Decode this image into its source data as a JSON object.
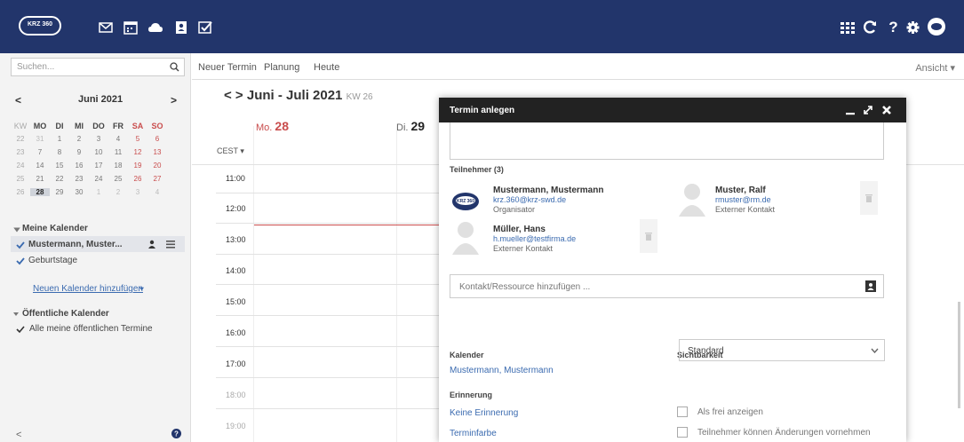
{
  "app": {
    "logo_text": "KRZ 360"
  },
  "topbar": {
    "left_icons": [
      "mail-icon",
      "calendar-icon",
      "cloud-icon",
      "contacts-icon",
      "tasks-icon"
    ],
    "right_icons": [
      "apps-grid-icon",
      "refresh-icon",
      "help-icon",
      "settings-icon",
      "user-avatar-icon"
    ],
    "help_glyph": "?"
  },
  "sidebar": {
    "search_placeholder": "Suchen...",
    "month_title": "Juni 2021",
    "prev": "<",
    "next": ">",
    "weekday_headers": [
      "KW",
      "MO",
      "DI",
      "MI",
      "DO",
      "FR",
      "SA",
      "SO"
    ],
    "weeks": [
      [
        "22",
        "31",
        "1",
        "2",
        "3",
        "4",
        "5",
        "6"
      ],
      [
        "23",
        "7",
        "8",
        "9",
        "10",
        "11",
        "12",
        "13"
      ],
      [
        "24",
        "14",
        "15",
        "16",
        "17",
        "18",
        "19",
        "20"
      ],
      [
        "25",
        "21",
        "22",
        "23",
        "24",
        "25",
        "26",
        "27"
      ],
      [
        "26",
        "28",
        "29",
        "30",
        "1",
        "2",
        "3",
        "4"
      ]
    ],
    "my_calendars_label": "Meine Kalender",
    "calendar_item": "Mustermann, Muster...",
    "birthdays": "Geburtstage",
    "add_calendar_link": "Neuen Kalender hinzufügen",
    "public_calendars_label": "Öffentliche Kalender",
    "public_item": "Alle meine öffentlichen Termine",
    "collapse": "<"
  },
  "toolbar": {
    "new_event": "Neuer Termin",
    "planning": "Planung",
    "today": "Heute",
    "view": "Ansicht"
  },
  "calendar": {
    "range_title": "Juni - Juli 2021",
    "week_label": "KW 26",
    "nav_glyphs": "< >",
    "day1_prefix": "Mo.",
    "day1_num": "28",
    "day2_prefix": "Di.",
    "day2_num": "29",
    "timezone": "CEST",
    "times": [
      "11:00",
      "12:00",
      "13:00",
      "14:00",
      "15:00",
      "16:00",
      "17:00",
      "18:00",
      "19:00"
    ]
  },
  "dialog": {
    "title": "Termin anlegen",
    "participants_label": "Teilnehmer (3)",
    "participants": [
      {
        "name": "Mustermann, Mustermann",
        "email": "krz.360@krz-swd.de",
        "role": "Organisator"
      },
      {
        "name": "Muster, Ralf",
        "email": "rmuster@rm.de",
        "role": "Externer Kontakt"
      },
      {
        "name": "Müller, Hans",
        "email": "h.mueller@testfirma.de",
        "role": "Externer Kontakt"
      }
    ],
    "add_placeholder": "Kontakt/Ressource hinzufügen ...",
    "calendar_label": "Kalender",
    "calendar_value": "Mustermann, Mustermann",
    "visibility_label": "Sichtbarkeit",
    "visibility_value": "Standard",
    "reminder_label": "Erinnerung",
    "reminder_value": "Keine Erinnerung",
    "color_label": "Terminfarbe",
    "free_label": "Als frei anzeigen",
    "modify_label": "Teilnehmer können Änderungen vornehmen"
  },
  "colors": {
    "topbar": "#22356b",
    "weekend": "#c94d4d",
    "link": "#3b6bb0",
    "now_line": "#c94d4d"
  }
}
